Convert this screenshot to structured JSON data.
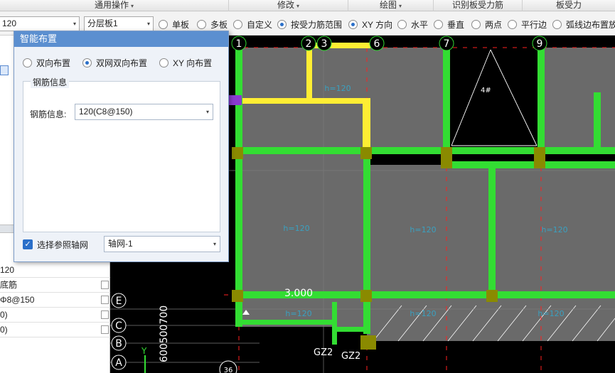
{
  "ribbon": {
    "groups": [
      {
        "label": "通用操作",
        "caret": "▾"
      },
      {
        "label": "修改",
        "caret": "▾"
      },
      {
        "label": "绘图",
        "caret": "▾"
      },
      {
        "label": "识别板受力筋",
        "caret": ""
      },
      {
        "label": "板受力",
        "caret": ""
      }
    ]
  },
  "toolbar": {
    "thickness_combo": "120",
    "layer_combo": "分层板1",
    "combo_arrow": "▾",
    "options": [
      {
        "label": "单板",
        "selected": false
      },
      {
        "label": "多板",
        "selected": false
      },
      {
        "label": "自定义",
        "selected": false
      },
      {
        "label": "按受力筋范围",
        "selected": true
      },
      {
        "label": "XY 方向",
        "selected": true
      },
      {
        "label": "水平",
        "selected": false
      },
      {
        "label": "垂直",
        "selected": false
      },
      {
        "label": "两点",
        "selected": false
      },
      {
        "label": "平行边",
        "selected": false
      },
      {
        "label": "弧线边布置放",
        "selected": false
      }
    ]
  },
  "dialog": {
    "title": "智能布置",
    "layout_options": [
      {
        "label": "双向布置",
        "selected": false
      },
      {
        "label": "双网双向布置",
        "selected": true
      },
      {
        "label": "XY 向布置",
        "selected": false
      }
    ],
    "group_title": "钢筋信息",
    "rebar_label": "钢筋信息:",
    "rebar_value": "120(C8@150)",
    "ref_axis_label": "选择参照轴网",
    "ref_axis_checked": true,
    "ref_axis_value": "轴网-1",
    "check_mark": "✓",
    "combo_arrow": "▾"
  },
  "properties": {
    "rows": [
      "120",
      "底筋",
      "Φ8@150",
      "0)",
      "0)"
    ]
  },
  "canvas": {
    "axis_top": [
      "1",
      "2",
      "3",
      "6",
      "7",
      "9"
    ],
    "axis_left": [
      "E",
      "C",
      "B",
      "A"
    ],
    "slab_labels": [
      "h=120",
      "h=120",
      "h=120",
      "h=120",
      "h=120",
      "h=120",
      "h=120"
    ],
    "elevation": "3.000",
    "column_tags": [
      "GZ2",
      "GZ2"
    ],
    "axis_dim": "600500700",
    "misc_number": "36",
    "cell_mark": "4#",
    "y_axis_label": "Y",
    "colors": {
      "background": "#000000",
      "beam": "#33dd33",
      "wall": "#ffee33",
      "slab": "#6a6a6a",
      "column": "#8a8a00",
      "axis_line": "#ff2020"
    }
  }
}
